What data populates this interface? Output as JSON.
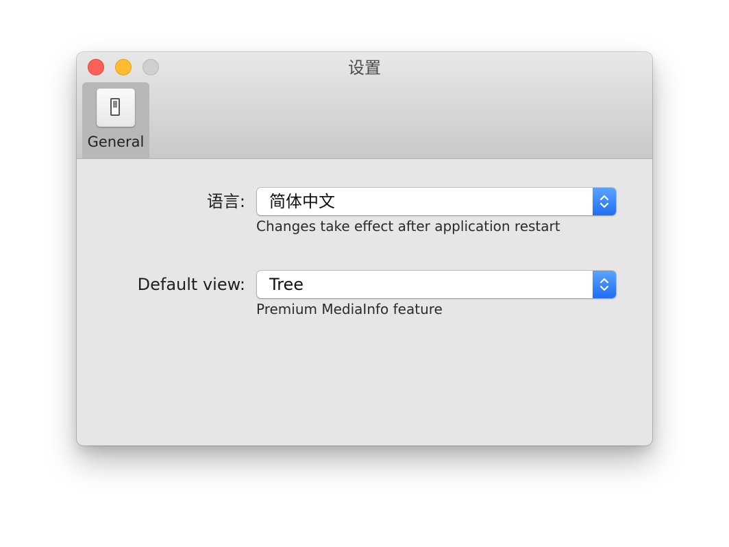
{
  "window": {
    "title": "设置",
    "controls": {
      "close_color": "#fe5f57",
      "minimize_color": "#febc2e",
      "zoom_color": "#cfcfcf"
    }
  },
  "toolbar": {
    "items": [
      {
        "label": "General",
        "icon": "light-switch-icon",
        "selected": true
      }
    ]
  },
  "settings": {
    "language": {
      "label": "语言:",
      "value": "简体中文",
      "hint": "Changes take effect after application restart"
    },
    "default_view": {
      "label": "Default view:",
      "value": "Tree",
      "hint": "Premium MediaInfo feature"
    }
  },
  "colors": {
    "accent": "#1f6ff2",
    "window_background": "#e6e6e6"
  }
}
